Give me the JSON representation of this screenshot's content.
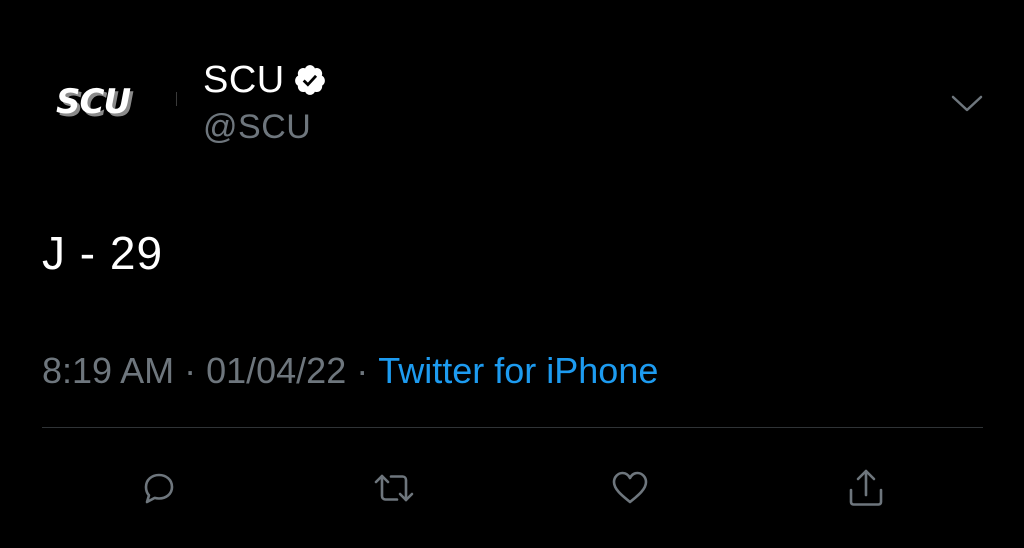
{
  "author": {
    "avatar_text": "SCU",
    "display_name": "SCU",
    "handle": "@SCU",
    "verified": true,
    "verified_icon": "verified-badge-icon"
  },
  "tweet": {
    "text": "J - 29"
  },
  "meta": {
    "time": "8:19 AM",
    "separator": "·",
    "date": "01/04/22",
    "source": "Twitter for iPhone"
  },
  "actions": [
    {
      "name": "reply",
      "icon": "comment-icon"
    },
    {
      "name": "retweet",
      "icon": "retweet-icon"
    },
    {
      "name": "like",
      "icon": "heart-icon"
    },
    {
      "name": "share",
      "icon": "share-icon"
    }
  ],
  "colors": {
    "background": "#000000",
    "primary_text": "#ffffff",
    "secondary_text": "#6e767d",
    "link": "#1d9bf0",
    "divider": "#2f3336"
  }
}
